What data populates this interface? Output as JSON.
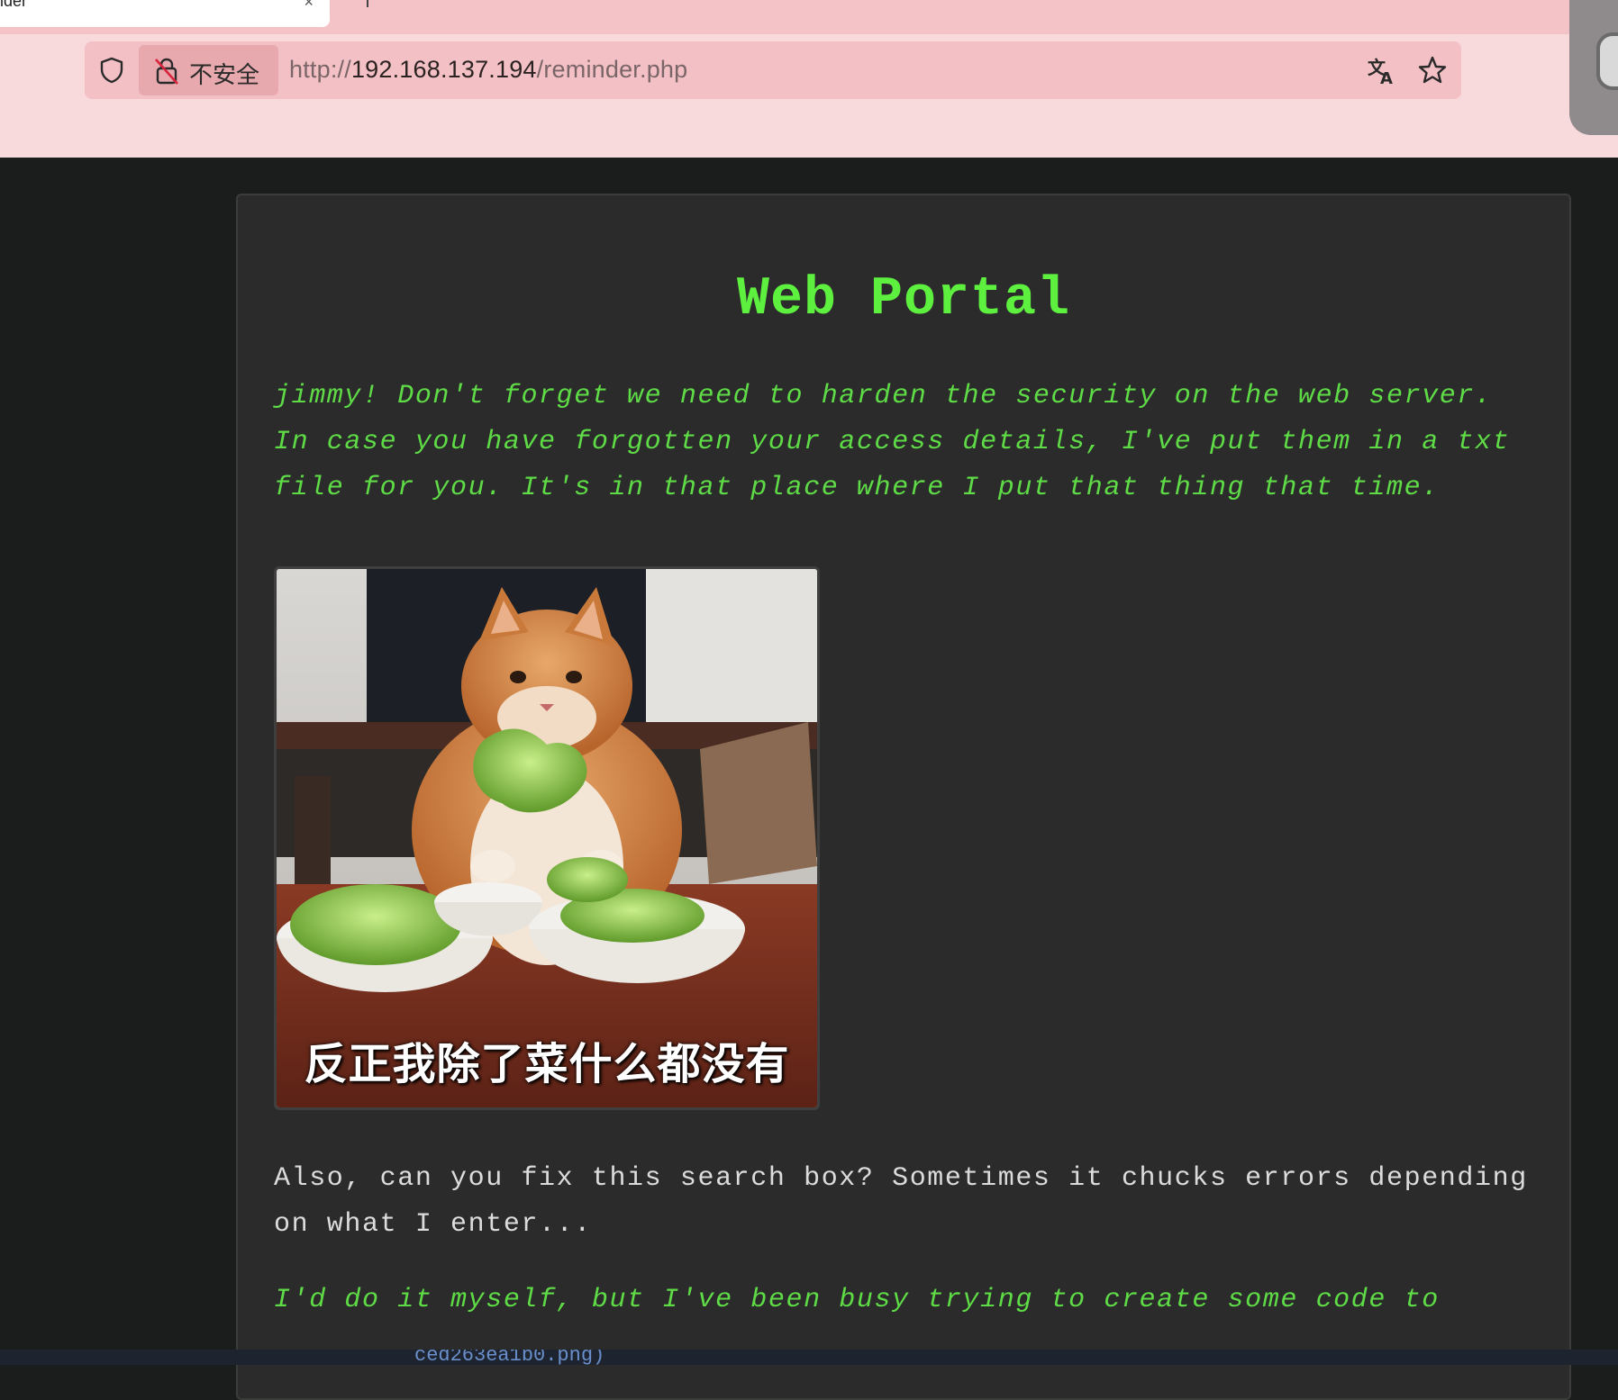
{
  "browser": {
    "tab_title": "ider",
    "tab_close": "×",
    "security_label": "不安全",
    "url_scheme": "http://",
    "url_host": "192.168.137.194",
    "url_path": "/reminder.php"
  },
  "page": {
    "title": "Web Portal",
    "note": "jimmy! Don't forget we need to harden the security on the web server. In case you have forgotten your access details, I've put them in a txt file for you. It's in that place where I put that thing that time.",
    "meme_caption": "反正我除了菜什么都没有",
    "search_note": "Also, can you fix this search box? Sometimes it chucks errors depending on what I enter...",
    "busy_note": "I'd do it myself, but I've been busy trying to create some code to"
  },
  "bottom_strip": {
    "text": "ced263ea1b0.png)"
  },
  "colors": {
    "chrome_bg": "#f8d9dc",
    "urlbar_bg": "#f3c0c5",
    "page_bg": "#1b1c1c",
    "panel_bg": "#2b2b2b",
    "title_green": "#5ef03f",
    "text_green": "#5edb46",
    "text_light": "#dcdcdc"
  },
  "icons": {
    "shield": "shield-icon",
    "lock": "lock-slash-icon",
    "translate": "translate-icon",
    "bookmark": "star-icon",
    "new_tab": "plus-icon"
  }
}
